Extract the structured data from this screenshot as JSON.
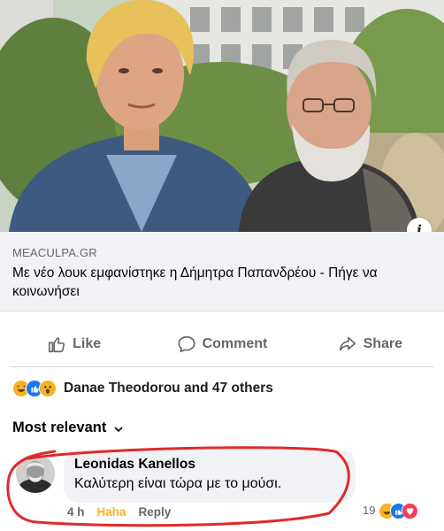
{
  "link_preview": {
    "domain": "MEACULPA.GR",
    "title": "Με νέο λουκ εμφανίστηκε η Δήμητρα Παπανδρέου - Πήγε να κοινωνήσει",
    "info_badge": "i"
  },
  "actions": {
    "like": "Like",
    "comment": "Comment",
    "share": "Share"
  },
  "reactions": {
    "summary": "Danae Theodorou and 47 others",
    "icons": [
      "haha-icon",
      "like-icon",
      "wow-icon"
    ]
  },
  "sort": {
    "label": "Most relevant"
  },
  "comment": {
    "author": "Leonidas Kanellos",
    "text": "Καλύτερη είναι τώρα με το μούσι.",
    "time": "4 h",
    "reaction_label": "Haha",
    "reply_label": "Reply",
    "reaction_count": "19",
    "reaction_icons": [
      "haha-icon",
      "like-icon",
      "love-icon"
    ]
  },
  "colors": {
    "secondary_text": "#65676b",
    "caption_bg": "#f0f2f5",
    "haha": "#f7b125",
    "like": "#1877f2",
    "love": "#f33e58",
    "highlight": "#e02a2a"
  }
}
